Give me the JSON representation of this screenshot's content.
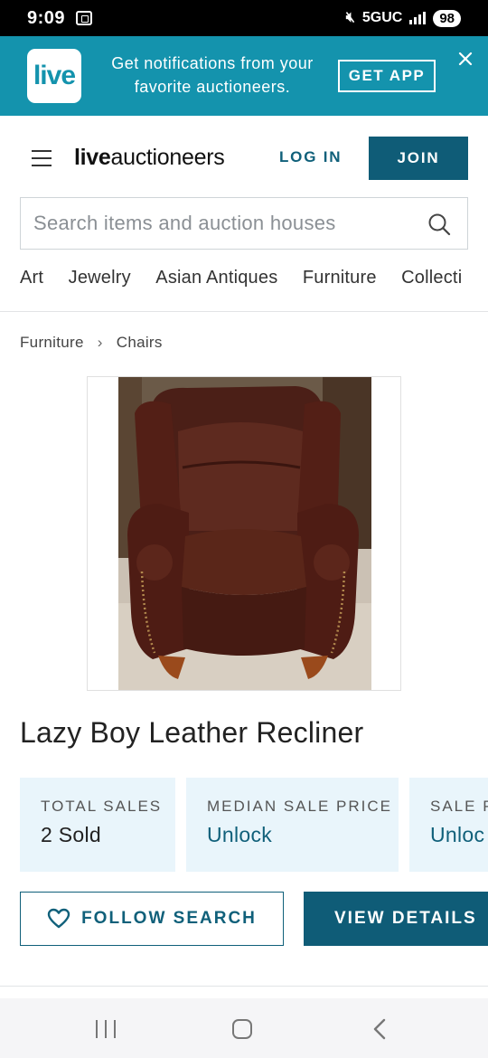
{
  "status_bar": {
    "time": "9:09",
    "network": "5GUC",
    "battery": "98"
  },
  "banner": {
    "logo_text": "live",
    "message": "Get notifications from your favorite auctioneers.",
    "cta_label": "GET APP",
    "close_icon": "close-icon"
  },
  "header": {
    "logo_bold": "live",
    "logo_light": "auctioneers",
    "login_label": "LOG IN",
    "join_label": "JOIN"
  },
  "search": {
    "placeholder": "Search items and auction houses",
    "icon": "search-icon"
  },
  "categories": [
    "Art",
    "Jewelry",
    "Asian Antiques",
    "Furniture",
    "Collecti"
  ],
  "breadcrumb": {
    "parent": "Furniture",
    "current": "Chairs"
  },
  "item": {
    "title": "Lazy Boy Leather Recliner",
    "image_subject": "Brown leather wingback recliner chair"
  },
  "stats": [
    {
      "label": "TOTAL SALES",
      "value": "2 Sold"
    },
    {
      "label": "MEDIAN SALE PRICE",
      "value": "Unlock"
    },
    {
      "label": "SALE P",
      "value": "Unloc"
    }
  ],
  "actions": {
    "follow_label": "FOLLOW SEARCH",
    "view_details_label": "VIEW DETAILS"
  },
  "colors": {
    "brand_teal": "#1493ad",
    "primary_dark": "#0f5c77",
    "stat_bg": "#e9f5fb"
  }
}
